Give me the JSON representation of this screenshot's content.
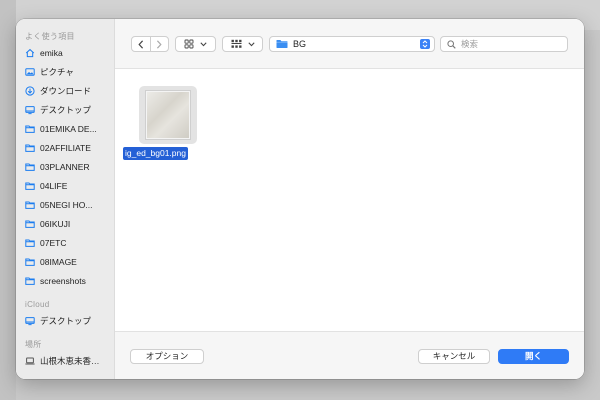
{
  "sidebar": {
    "sections": [
      {
        "title": "よく使う項目",
        "items": [
          {
            "label": "emika",
            "icon": "home-icon"
          },
          {
            "label": "ピクチャ",
            "icon": "photo-icon"
          },
          {
            "label": "ダウンロード",
            "icon": "download-icon"
          },
          {
            "label": "デスクトップ",
            "icon": "desktop-icon"
          },
          {
            "label": "01EMIKA DE...",
            "icon": "folder-icon"
          },
          {
            "label": "02AFFILIATE",
            "icon": "folder-icon"
          },
          {
            "label": "03PLANNER",
            "icon": "folder-icon"
          },
          {
            "label": "04LIFE",
            "icon": "folder-icon"
          },
          {
            "label": "05NEGI HO...",
            "icon": "folder-icon"
          },
          {
            "label": "06IKUJI",
            "icon": "folder-icon"
          },
          {
            "label": "07ETC",
            "icon": "folder-icon"
          },
          {
            "label": "08IMAGE",
            "icon": "folder-icon"
          },
          {
            "label": "screenshots",
            "icon": "folder-icon"
          }
        ]
      },
      {
        "title": "iCloud",
        "items": [
          {
            "label": "デスクトップ",
            "icon": "desktop-icon"
          }
        ]
      },
      {
        "title": "場所",
        "items": [
          {
            "label": "山根木恵未香…",
            "icon": "laptop-icon"
          }
        ]
      }
    ]
  },
  "toolbar": {
    "back_icon": "chevron-left-icon",
    "forward_icon": "chevron-right-icon",
    "view_icon": "grid-icon",
    "group_icon": "group-grid-icon",
    "path": "BG",
    "search_placeholder": "検索"
  },
  "files": [
    {
      "name": "ig_ed_bg01.png",
      "selected": true
    }
  ],
  "buttons": {
    "options": "オプション",
    "cancel": "キャンセル",
    "open": "開く"
  },
  "colors": {
    "accent": "#2f7bf6",
    "selection": "#2460d6",
    "folder": "#1a7cf0"
  }
}
